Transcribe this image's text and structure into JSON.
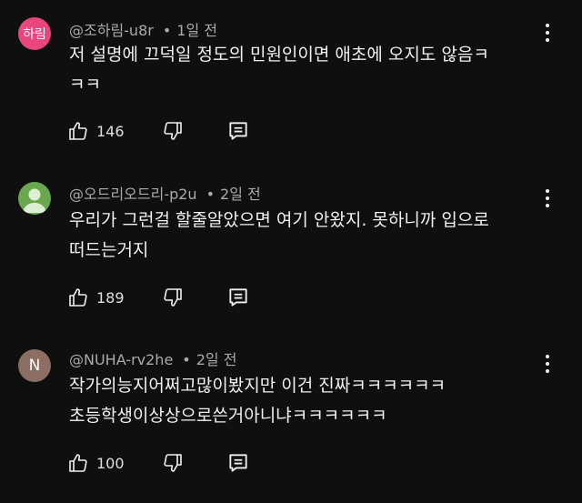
{
  "comments": [
    {
      "avatar": {
        "type": "text",
        "text": "하림",
        "bg": "#e8467d"
      },
      "author": "@조하림-u8r",
      "time": "1일 전",
      "lines": [
        "저 설명에 끄덕일 정도의 민원인이면 애초에 오지도 않음ㅋ",
        "ㅋㅋ"
      ],
      "likes": "146"
    },
    {
      "avatar": {
        "type": "default-person",
        "bg": "#6aa84f"
      },
      "author": "@오드리오드리-p2u",
      "time": "2일 전",
      "lines": [
        "우리가 그런걸 할줄알았으면 여기 안왔지.  못하니까 입으로",
        "떠드는거지"
      ],
      "likes": "189"
    },
    {
      "avatar": {
        "type": "text",
        "text": "N",
        "bg": "#8d6e63"
      },
      "author": "@NUHA-rv2he",
      "time": "2일 전",
      "lines": [
        "작가의능지어쩌고많이봤지만 이건 진짜ㅋㅋㅋㅋㅋㅋ",
        "초등학생이상상으로쓴거아니냐ㅋㅋㅋㅋㅋㅋ"
      ],
      "likes": "100"
    }
  ],
  "icons": {
    "like": "thumbs-up-icon",
    "dislike": "thumbs-down-icon",
    "reply": "reply-comment-icon",
    "menu": "more-vertical-icon"
  },
  "colors": {
    "background": "#0f0f0f",
    "meta_text": "#aaaaaa",
    "body_text": "#f1f1f1"
  }
}
